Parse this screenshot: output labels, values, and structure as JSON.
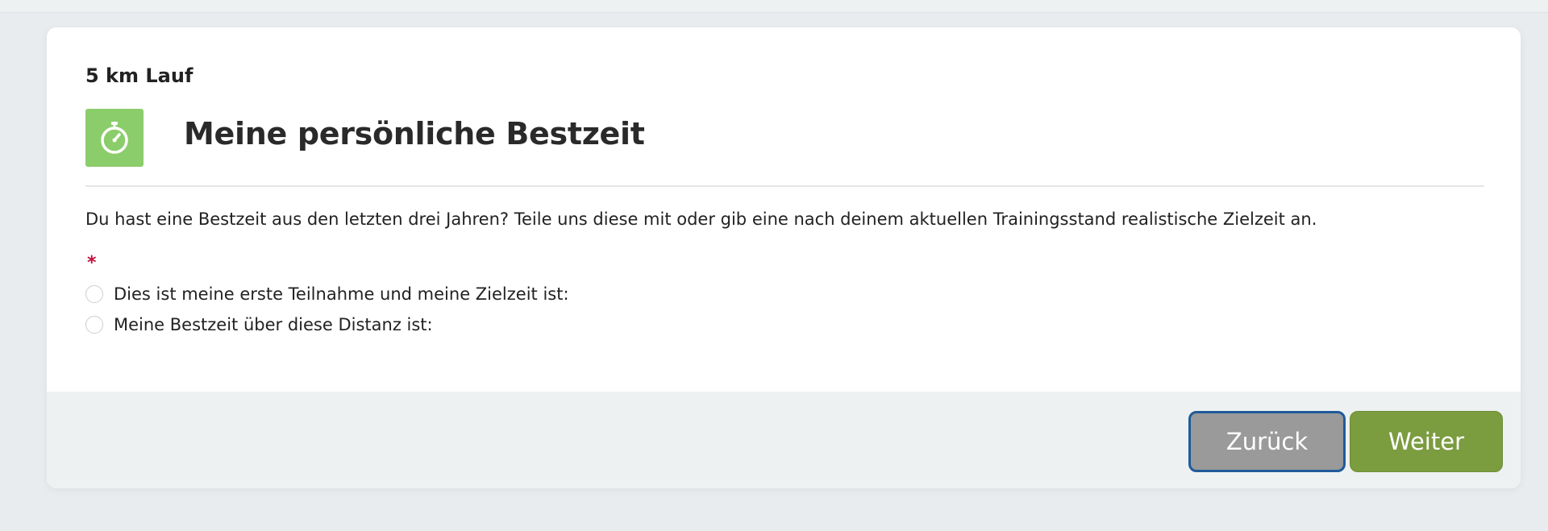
{
  "form": {
    "subtitle": "5 km Lauf",
    "title": "Meine persönliche Bestzeit",
    "icon": "stopwatch-icon",
    "description": "Du hast eine Bestzeit aus den letzten drei Jahren? Teile uns diese mit oder gib eine nach deinem aktuellen Trainingsstand realistische Zielzeit an.",
    "required_marker": "*",
    "options": [
      {
        "label": "Dies ist meine erste Teilnahme und meine Zielzeit ist:",
        "selected": false
      },
      {
        "label": "Meine Bestzeit über diese Distanz ist:",
        "selected": false
      }
    ]
  },
  "footer": {
    "back_label": "Zurück",
    "next_label": "Weiter"
  },
  "colors": {
    "icon_bg": "#8ccd6b",
    "back_button": "#9a9a9a",
    "back_button_focus_border": "#1f5b9a",
    "next_button": "#7b9c3f",
    "required": "#c0103a"
  }
}
